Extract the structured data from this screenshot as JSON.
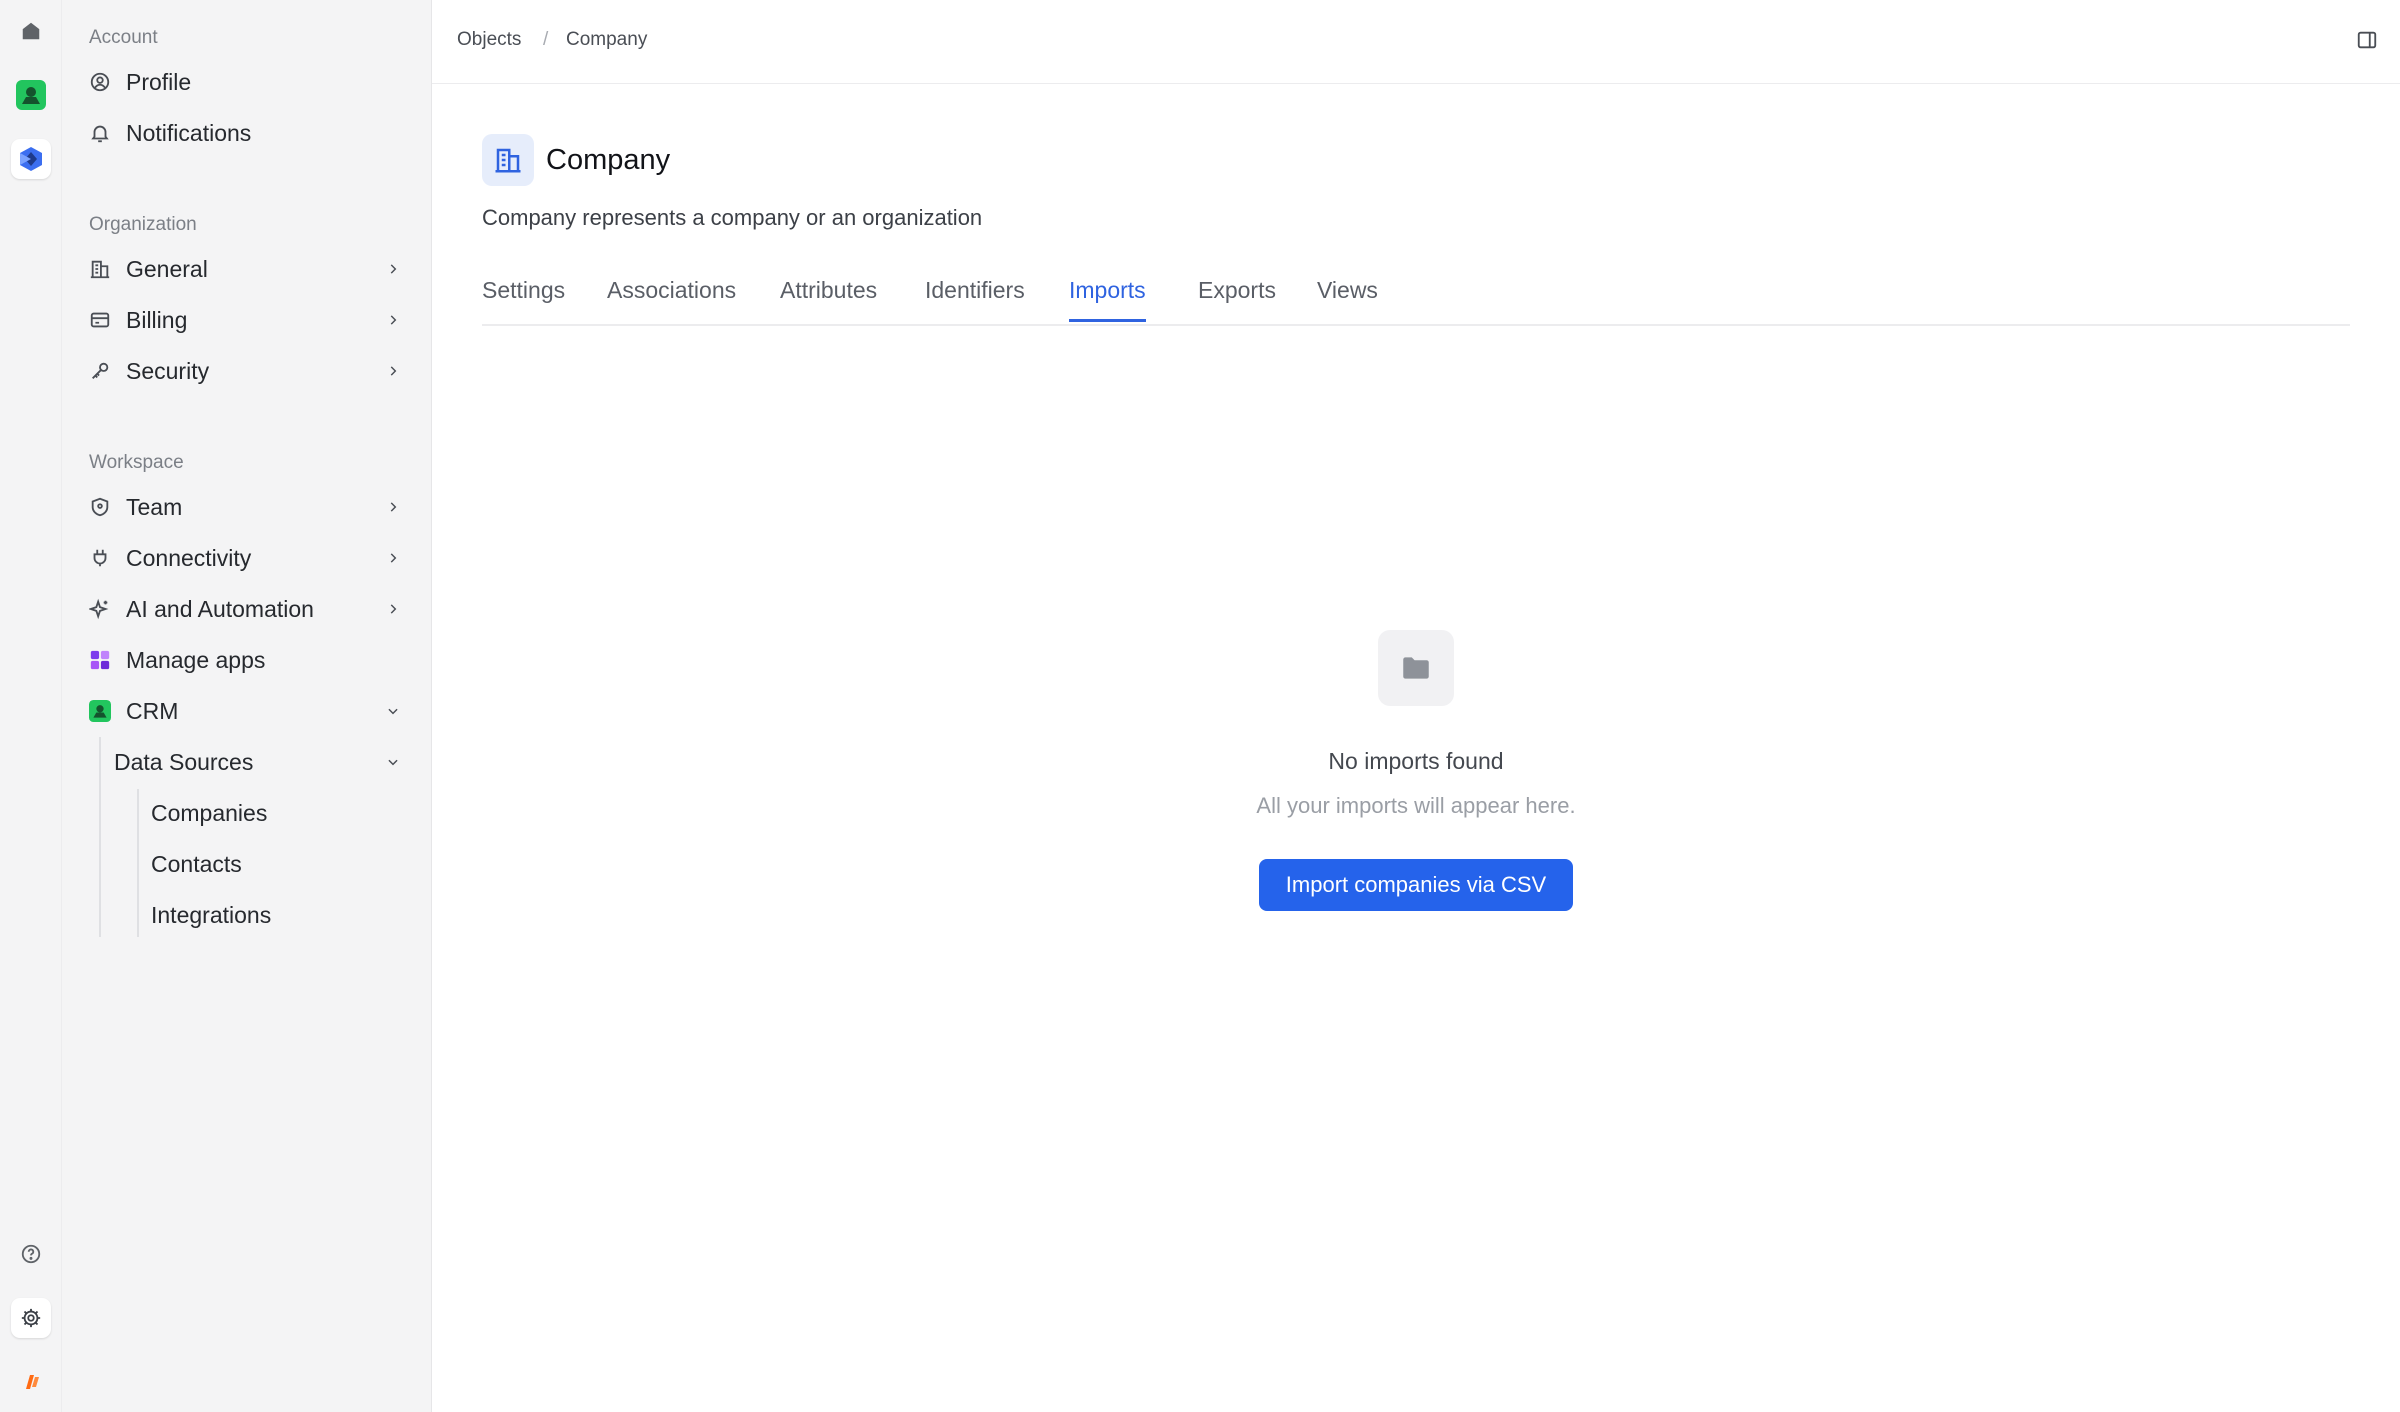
{
  "colors": {
    "accent": "#2563eb",
    "active_tab": "#2f63e0",
    "crm_green": "#22c55e",
    "brand_orange": "#ff6a13",
    "apps_purple": "#9333ea"
  },
  "rail": {
    "items": [
      {
        "icon": "home-icon"
      },
      {
        "icon": "crm-app-icon"
      },
      {
        "icon": "workspace-logo-icon"
      },
      {
        "icon": "help-icon"
      },
      {
        "icon": "settings-icon"
      },
      {
        "icon": "brand-logo-icon"
      }
    ]
  },
  "sidebar": {
    "account": {
      "label": "Account",
      "items": [
        {
          "label": "Profile",
          "icon": "user-circle-icon"
        },
        {
          "label": "Notifications",
          "icon": "bell-icon"
        }
      ]
    },
    "organization": {
      "label": "Organization",
      "items": [
        {
          "label": "General",
          "icon": "building-icon"
        },
        {
          "label": "Billing",
          "icon": "credit-card-icon"
        },
        {
          "label": "Security",
          "icon": "key-icon"
        }
      ]
    },
    "workspace": {
      "label": "Workspace",
      "items": [
        {
          "label": "Team",
          "icon": "shield-icon"
        },
        {
          "label": "Connectivity",
          "icon": "plug-icon"
        },
        {
          "label": "AI and Automation",
          "icon": "sparkle-icon"
        },
        {
          "label": "Manage apps",
          "icon": "apps-icon"
        },
        {
          "label": "CRM",
          "icon": "crm-icon"
        }
      ]
    },
    "crm": {
      "data_sources": "Data Sources",
      "children": [
        "Companies",
        "Contacts",
        "Integrations"
      ]
    }
  },
  "header": {
    "breadcrumb": [
      "Objects",
      "Company"
    ],
    "separator": "/"
  },
  "object": {
    "title": "Company",
    "description": "Company represents a company or an organization",
    "icon": "building-icon"
  },
  "tabs": {
    "items": [
      "Settings",
      "Associations",
      "Attributes",
      "Identifiers",
      "Imports",
      "Exports",
      "Views"
    ],
    "active": "Imports"
  },
  "empty_state": {
    "icon": "folder-icon",
    "title": "No imports found",
    "subtitle": "All your imports will appear here.",
    "button_label": "Import companies via CSV"
  }
}
